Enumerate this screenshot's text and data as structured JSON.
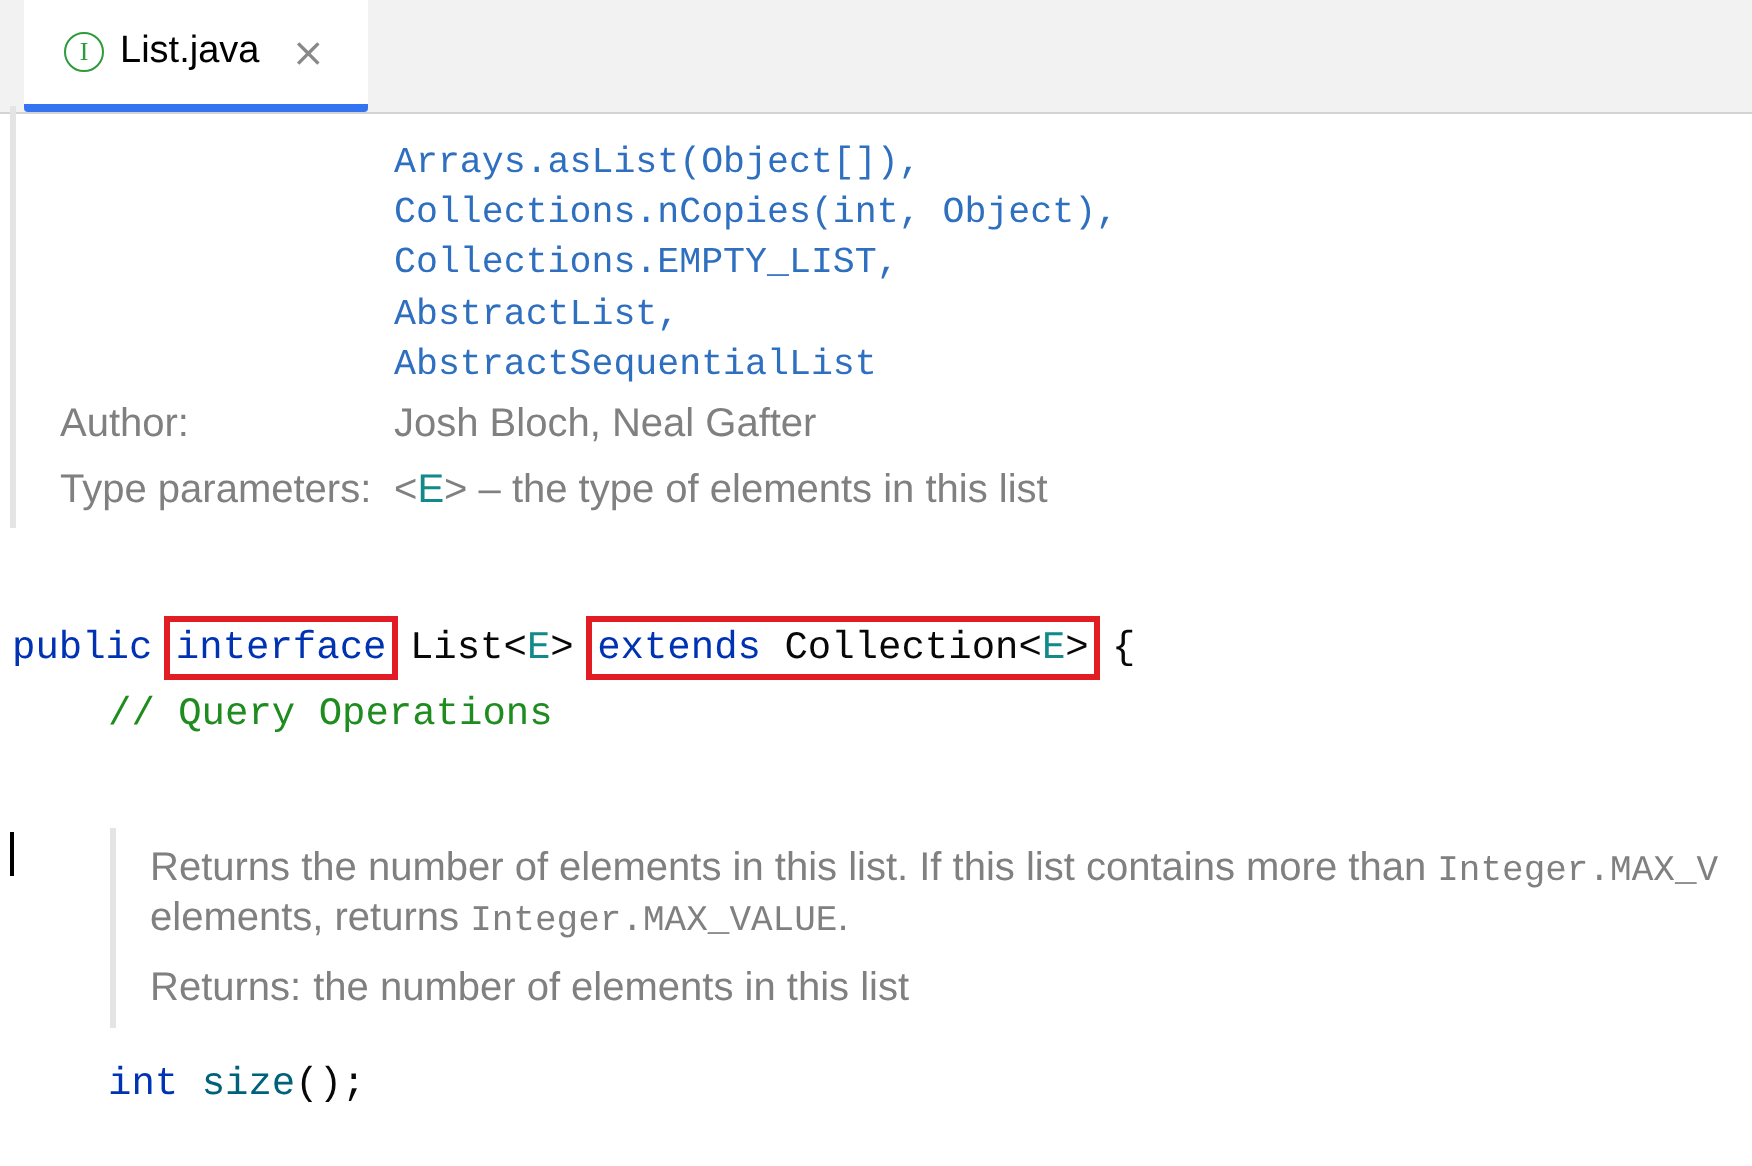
{
  "tabs": [
    {
      "badge": "I",
      "label": "List.java",
      "close": "×",
      "selected": true
    }
  ],
  "doc_top": {
    "links": [
      "Arrays.asList(Object[]),",
      "Collections.nCopies(int, Object),",
      "Collections.EMPTY_LIST,",
      "AbstractList,",
      "AbstractSequentialList"
    ],
    "fields": [
      {
        "label": "Author:",
        "parts": [
          {
            "kind": "text",
            "text": "Josh Bloch, Neal Gafter"
          }
        ]
      },
      {
        "label": "Type parameters:",
        "parts": [
          {
            "kind": "text",
            "text": "<"
          },
          {
            "kind": "param",
            "text": "E"
          },
          {
            "kind": "text",
            "text": "> – the type of elements in this list"
          }
        ]
      }
    ]
  },
  "declaration": {
    "words": [
      {
        "kind": "word",
        "pieces": [
          {
            "kind": "keyword",
            "text": "public"
          }
        ]
      },
      {
        "kind": "group",
        "highlighted": true,
        "words": [
          {
            "kind": "word",
            "pieces": [
              {
                "kind": "keyword",
                "text": "interface"
              }
            ]
          }
        ]
      },
      {
        "kind": "word",
        "pieces": [
          {
            "kind": "plain",
            "text": "List<"
          },
          {
            "kind": "param",
            "text": "E"
          },
          {
            "kind": "plain",
            "text": ">"
          }
        ]
      },
      {
        "kind": "group",
        "highlighted": true,
        "words": [
          {
            "kind": "word",
            "pieces": [
              {
                "kind": "keyword",
                "text": "extends"
              }
            ]
          },
          {
            "kind": "word",
            "pieces": [
              {
                "kind": "plain",
                "text": "Collection<"
              },
              {
                "kind": "param",
                "text": "E"
              },
              {
                "kind": "plain",
                "text": ">"
              }
            ]
          }
        ]
      },
      {
        "kind": "word",
        "pieces": [
          {
            "kind": "plain",
            "text": "{"
          }
        ]
      }
    ],
    "children": [
      {
        "words": [
          {
            "kind": "word",
            "pieces": [
              {
                "kind": "comment",
                "text": "// Query Operations"
              }
            ]
          }
        ]
      }
    ]
  },
  "doc_method": {
    "description": [
      {
        "kind": "text",
        "text": "Returns the number of elements in this list. If this list contains more than "
      },
      {
        "kind": "code",
        "text": "Integer.MAX_V"
      },
      {
        "kind": "break"
      },
      {
        "kind": "text",
        "text": "elements, returns "
      },
      {
        "kind": "code",
        "text": "Integer.MAX_VALUE"
      },
      {
        "kind": "text",
        "text": "."
      }
    ],
    "returns_label": "Returns:",
    "returns_text": "the number of elements in this list"
  },
  "members": [
    {
      "words": [
        {
          "kind": "word",
          "pieces": [
            {
              "kind": "keyword",
              "text": "int"
            }
          ]
        },
        {
          "kind": "word",
          "pieces": [
            {
              "kind": "method",
              "text": "size"
            },
            {
              "kind": "plain",
              "text": "();"
            }
          ]
        }
      ]
    }
  ]
}
